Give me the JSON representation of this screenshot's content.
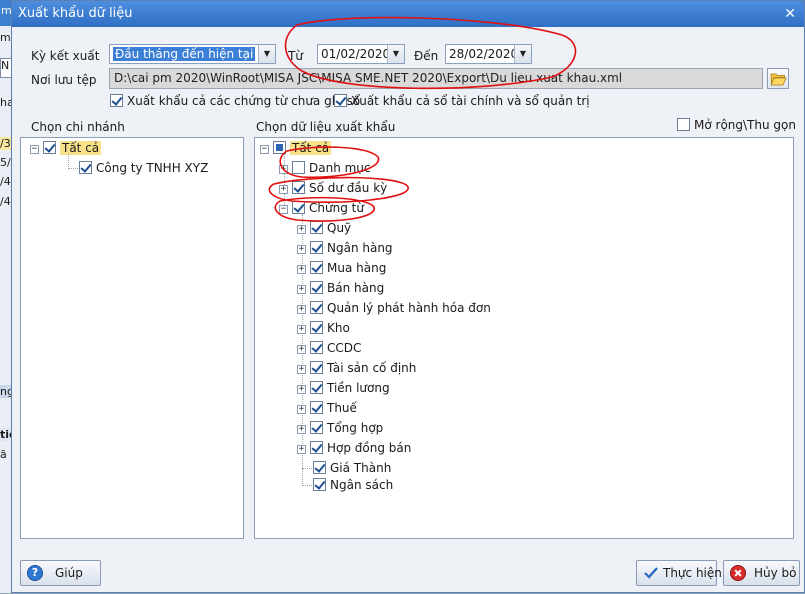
{
  "background_app": {
    "rows": [
      "m",
      "mu",
      "N",
      "ha",
      "/3",
      "5/0",
      "/4/0",
      "/4/0",
      "ng",
      "tiề",
      "ã h"
    ]
  },
  "window": {
    "title": "Xuất khẩu dữ liệu",
    "close_glyph": "✕"
  },
  "period": {
    "label": "Kỳ kết xuất",
    "value": "Đầu tháng đến hiện tại",
    "from_label": "Từ",
    "from_value": "01/02/2020",
    "to_label": "Đến",
    "to_value": "28/02/2020"
  },
  "save_path": {
    "label": "Nơi lưu tệp",
    "value": "D:\\cai pm 2020\\WinRoot\\MISA JSC\\MISA SME.NET 2020\\Export\\Du lieu xuat khau.xml"
  },
  "options": {
    "unposted_label": "Xuất khẩu cả các chứng từ chưa ghi sổ",
    "unposted_checked": true,
    "books_label": "Xuất khẩu cả sổ tài chính và sổ quản trị",
    "books_checked": true
  },
  "branch_panel": {
    "title": "Chọn chi nhánh",
    "root_label": "Tất cả",
    "items": [
      "Công ty TNHH XYZ"
    ]
  },
  "data_panel": {
    "title": "Chọn dữ liệu xuất khẩu",
    "expand_label": "Mở rộng\\Thu gọn",
    "root_label": "Tất cả",
    "top_items": [
      {
        "label": "Danh mục",
        "checked": false
      },
      {
        "label": "Số dư đầu kỳ",
        "checked": true
      },
      {
        "label": "Chứng từ",
        "checked": true
      }
    ],
    "voucher_items": [
      "Quỹ",
      "Ngân hàng",
      "Mua hàng",
      "Bán hàng",
      "Quản lý phát hành hóa đơn",
      "Kho",
      "CCDC",
      "Tài sản cố định",
      "Tiền lương",
      "Thuế",
      "Tổng hợp",
      "Hợp đồng bán"
    ],
    "leaf_items": [
      "Giá Thành",
      "Ngân sách"
    ]
  },
  "buttons": {
    "help": "Giúp",
    "run": "Thực hiện",
    "cancel": "Hủy bỏ"
  },
  "icons": {
    "help": "help-icon",
    "run": "checkmark-icon",
    "cancel": "cancel-icon",
    "folder": "folder-open-icon"
  },
  "colors": {
    "title_bar": "#2f6fc4",
    "annotation": "#e01010",
    "selection": "#3c7fd6",
    "root_highlight": "#f7e28a"
  }
}
